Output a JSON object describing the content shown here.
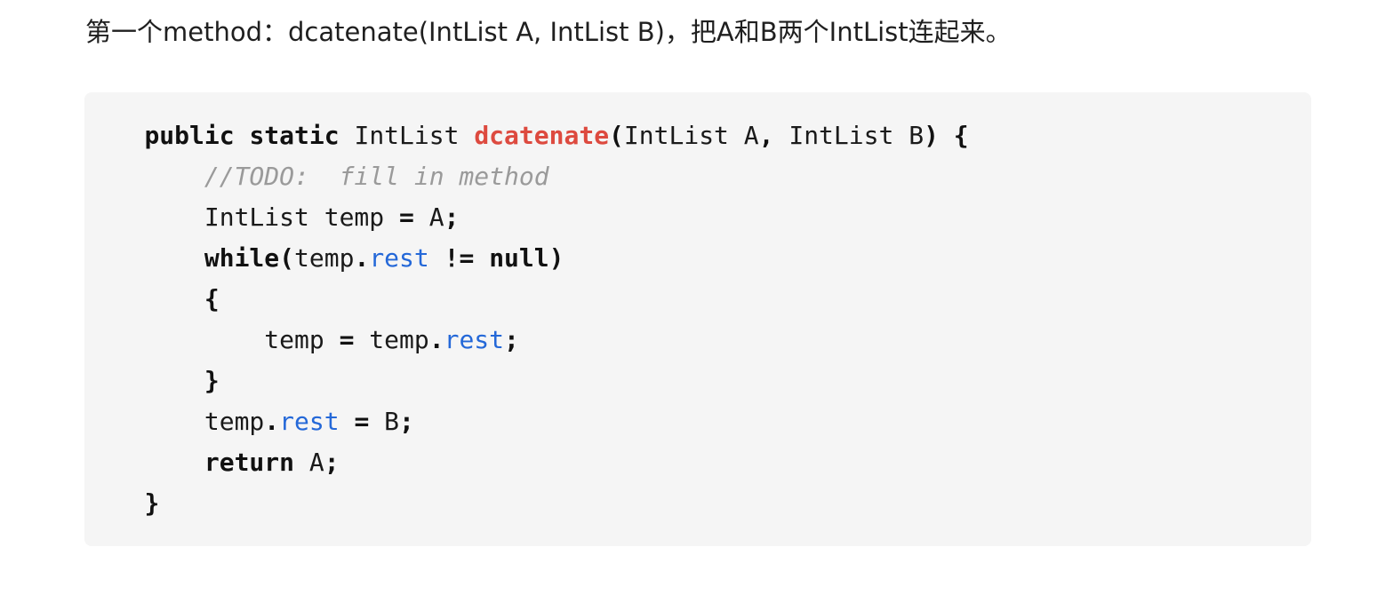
{
  "intro": {
    "text": "第一个method：dcatenate(IntList A, IntList B)，把A和B两个IntList连起来。"
  },
  "code": {
    "lines": [
      [
        {
          "t": "    ",
          "c": "tx"
        },
        {
          "t": "public",
          "c": "kw"
        },
        {
          "t": " ",
          "c": "tx"
        },
        {
          "t": "static",
          "c": "kw"
        },
        {
          "t": " IntList ",
          "c": "tx"
        },
        {
          "t": "dcatenate",
          "c": "fn"
        },
        {
          "t": "(",
          "c": "pn"
        },
        {
          "t": "IntList A",
          "c": "tx"
        },
        {
          "t": ",",
          "c": "pn"
        },
        {
          "t": " IntList B",
          "c": "tx"
        },
        {
          "t": ")",
          "c": "pn"
        },
        {
          "t": " ",
          "c": "tx"
        },
        {
          "t": "{",
          "c": "pn"
        }
      ],
      [
        {
          "t": "        ",
          "c": "tx"
        },
        {
          "t": "//TODO:  fill in method",
          "c": "cm"
        }
      ],
      [
        {
          "t": "        IntList temp ",
          "c": "tx"
        },
        {
          "t": "=",
          "c": "pn"
        },
        {
          "t": " A",
          "c": "tx"
        },
        {
          "t": ";",
          "c": "pn"
        }
      ],
      [
        {
          "t": "        ",
          "c": "tx"
        },
        {
          "t": "while",
          "c": "kw"
        },
        {
          "t": "(",
          "c": "pn"
        },
        {
          "t": "temp",
          "c": "tx"
        },
        {
          "t": ".",
          "c": "pn"
        },
        {
          "t": "rest",
          "c": "fld"
        },
        {
          "t": " ",
          "c": "tx"
        },
        {
          "t": "!=",
          "c": "pn"
        },
        {
          "t": " ",
          "c": "tx"
        },
        {
          "t": "null",
          "c": "kw"
        },
        {
          "t": ")",
          "c": "pn"
        }
      ],
      [
        {
          "t": "        ",
          "c": "tx"
        },
        {
          "t": "{",
          "c": "pn"
        }
      ],
      [
        {
          "t": "            temp ",
          "c": "tx"
        },
        {
          "t": "=",
          "c": "pn"
        },
        {
          "t": " temp",
          "c": "tx"
        },
        {
          "t": ".",
          "c": "pn"
        },
        {
          "t": "rest",
          "c": "fld"
        },
        {
          "t": ";",
          "c": "pn"
        }
      ],
      [
        {
          "t": "        ",
          "c": "tx"
        },
        {
          "t": "}",
          "c": "pn"
        }
      ],
      [
        {
          "t": "        temp",
          "c": "tx"
        },
        {
          "t": ".",
          "c": "pn"
        },
        {
          "t": "rest",
          "c": "fld"
        },
        {
          "t": " ",
          "c": "tx"
        },
        {
          "t": "=",
          "c": "pn"
        },
        {
          "t": " B",
          "c": "tx"
        },
        {
          "t": ";",
          "c": "pn"
        }
      ],
      [
        {
          "t": "        ",
          "c": "tx"
        },
        {
          "t": "return",
          "c": "kw"
        },
        {
          "t": " A",
          "c": "tx"
        },
        {
          "t": ";",
          "c": "pn"
        }
      ],
      [
        {
          "t": "    ",
          "c": "tx"
        },
        {
          "t": "}",
          "c": "pn"
        }
      ]
    ]
  },
  "colors": {
    "code_background": "#f5f5f5",
    "function_name": "#dd4a3f",
    "field": "#2468d8",
    "comment": "#9a9a9a"
  }
}
